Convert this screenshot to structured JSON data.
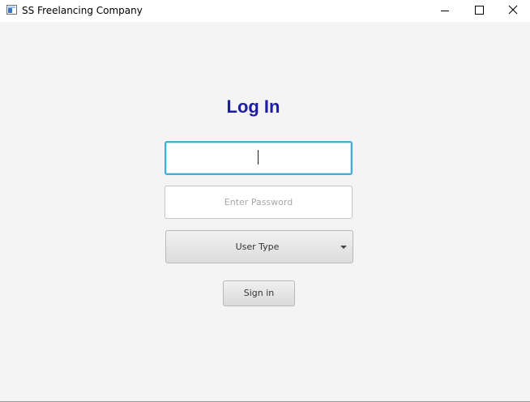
{
  "window": {
    "title": "SS Freelancing Company",
    "controls": {
      "minimize_icon": "minimize-icon",
      "maximize_icon": "maximize-icon",
      "close_icon": "close-icon"
    }
  },
  "login": {
    "heading": "Log In",
    "heading_color": "#1c1ca8",
    "username": {
      "value": "",
      "placeholder": "",
      "focused": true
    },
    "password": {
      "value": "",
      "placeholder": "Enter Password"
    },
    "user_type": {
      "selected": "User Type"
    },
    "signin_label": "Sign in"
  },
  "colors": {
    "focus_ring": "#3cb0d8",
    "background": "#f4f4f4"
  }
}
